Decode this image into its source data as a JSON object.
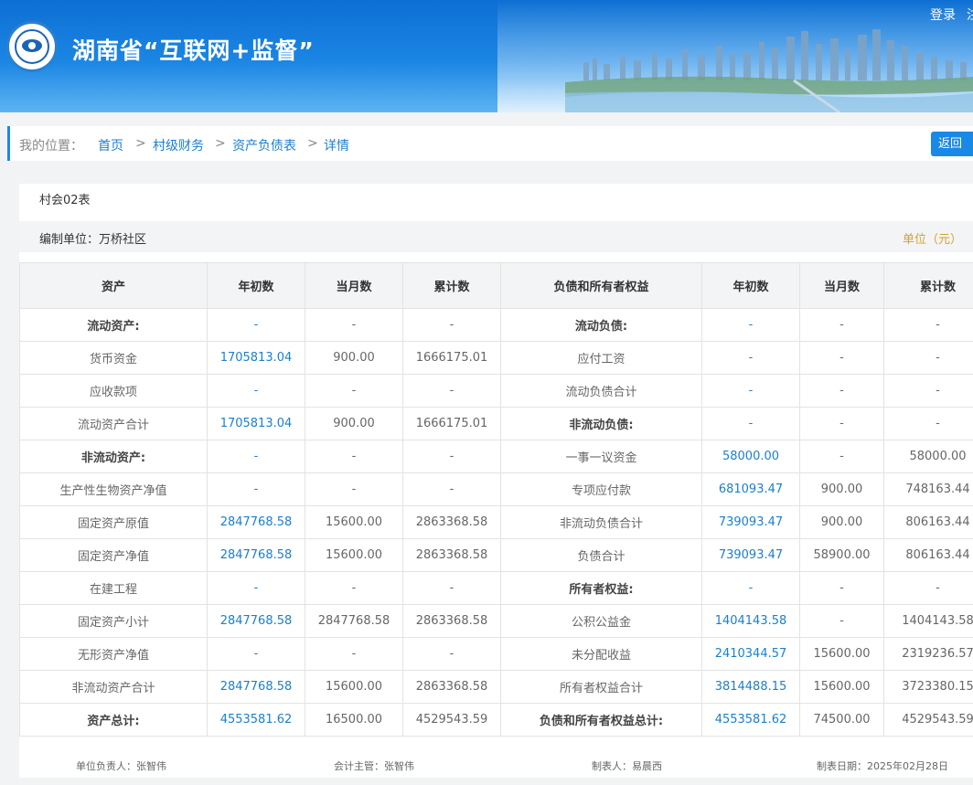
{
  "header": {
    "title": "湖南省“互联网+监督”",
    "login": "登录",
    "extra": "注",
    "logo_icon": "eye-seal-logo-icon"
  },
  "breadcrumb": {
    "label": "我的位置：",
    "items": [
      "首页",
      "村级财务",
      "资产负债表",
      "详情"
    ],
    "sep": ">",
    "back": "返回"
  },
  "report": {
    "code": "村会02表",
    "org": "编制单位：万桥社区",
    "unit": "单位（元）"
  },
  "table": {
    "headers": [
      "资产",
      "年初数",
      "当月数",
      "累计数",
      "负债和所有者权益",
      "年初数",
      "当月数",
      "累计数"
    ],
    "rows": [
      [
        "流动资产:",
        "-",
        "-",
        "-",
        "流动负债:",
        "-",
        "-",
        "-"
      ],
      [
        "货币资金",
        "1705813.04",
        "900.00",
        "1666175.01",
        "应付工资",
        "-",
        "-",
        "-"
      ],
      [
        "应收款项",
        "-",
        "-",
        "-",
        "流动负债合计",
        "-",
        "-",
        "-"
      ],
      [
        "流动资产合计",
        "1705813.04",
        "900.00",
        "1666175.01",
        "非流动负债:",
        "-",
        "-",
        "-"
      ],
      [
        "非流动资产:",
        "-",
        "-",
        "-",
        "一事一议资金",
        "58000.00",
        "-",
        "58000.00"
      ],
      [
        "生产性生物资产净值",
        "-",
        "-",
        "-",
        "专项应付款",
        "681093.47",
        "900.00",
        "748163.44"
      ],
      [
        "固定资产原值",
        "2847768.58",
        "15600.00",
        "2863368.58",
        "非流动负债合计",
        "739093.47",
        "900.00",
        "806163.44"
      ],
      [
        "固定资产净值",
        "2847768.58",
        "15600.00",
        "2863368.58",
        "负债合计",
        "739093.47",
        "58900.00",
        "806163.44"
      ],
      [
        "在建工程",
        "-",
        "-",
        "-",
        "所有者权益:",
        "-",
        "-",
        "-"
      ],
      [
        "固定资产小计",
        "2847768.58",
        "2847768.58",
        "2863368.58",
        "公积公益金",
        "1404143.58",
        "-",
        "1404143.58"
      ],
      [
        "无形资产净值",
        "-",
        "-",
        "-",
        "未分配收益",
        "2410344.57",
        "15600.00",
        "2319236.57"
      ],
      [
        "非流动资产合计",
        "2847768.58",
        "15600.00",
        "2863368.58",
        "所有者权益合计",
        "3814488.15",
        "15600.00",
        "3723380.15"
      ],
      [
        "资产总计:",
        "4553581.62",
        "16500.00",
        "4529543.59",
        "负债和所有者权益总计:",
        "4553581.62",
        "74500.00",
        "4529543.59"
      ]
    ],
    "bold_left_rows": [
      0,
      4,
      12
    ],
    "bold_right_rows": [
      0,
      3,
      8,
      12
    ]
  },
  "footer": {
    "leader": "单位负责人：张智伟",
    "accountant": "会计主管：张智伟",
    "preparer": "制表人：易晨西",
    "date": "制表日期：2025年02月28日"
  },
  "colors": {
    "accent": "#1a88e6",
    "link": "#1a7fd0",
    "unit": "#d4a32b"
  }
}
